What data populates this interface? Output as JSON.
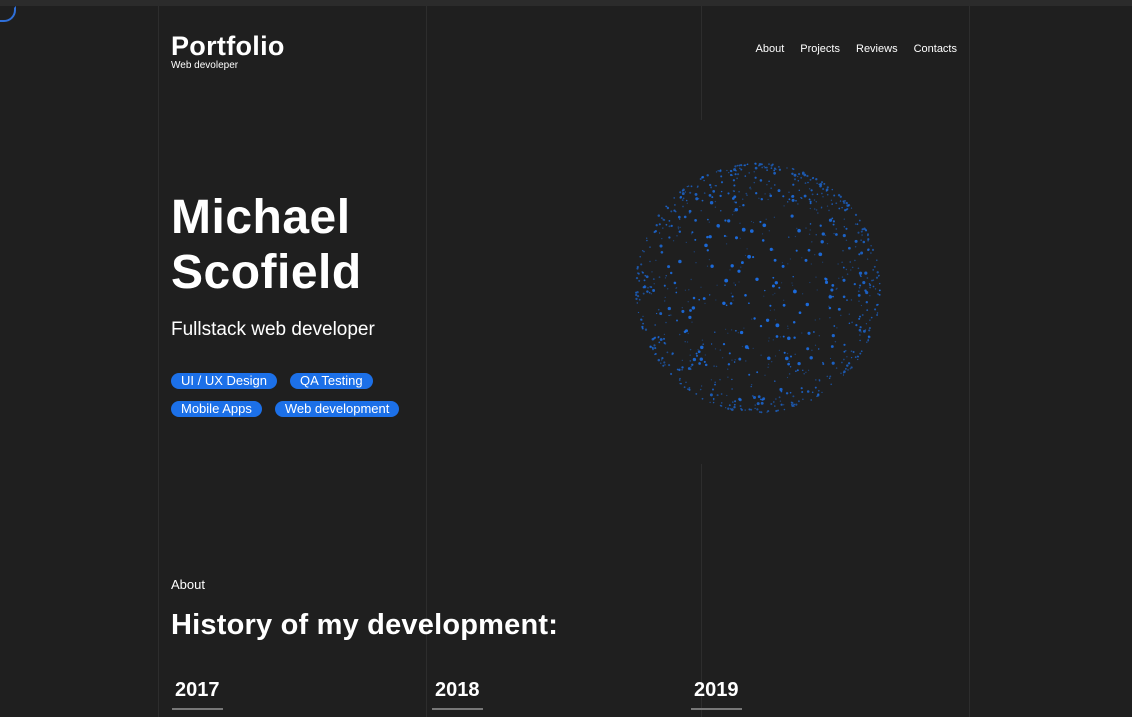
{
  "header": {
    "logo_title": "Portfolio",
    "logo_subtitle": "Web devoleper",
    "nav": [
      "About",
      "Projects",
      "Reviews",
      "Contacts"
    ]
  },
  "hero": {
    "name_line1": "Michael",
    "name_line2": "Scofield",
    "role": "Fullstack web developer",
    "tags": [
      "UI / UX Design",
      "QA Testing",
      "Mobile Apps",
      "Web development"
    ]
  },
  "about": {
    "label": "About",
    "title": "History of my development:",
    "years": [
      "2017",
      "2018",
      "2019"
    ]
  },
  "colors": {
    "background": "#1f1f1f",
    "accent": "#1c70e8",
    "text": "#ffffff"
  },
  "icons": {
    "loader": "loading-spinner-icon",
    "sphere": "particle-sphere-graphic"
  }
}
